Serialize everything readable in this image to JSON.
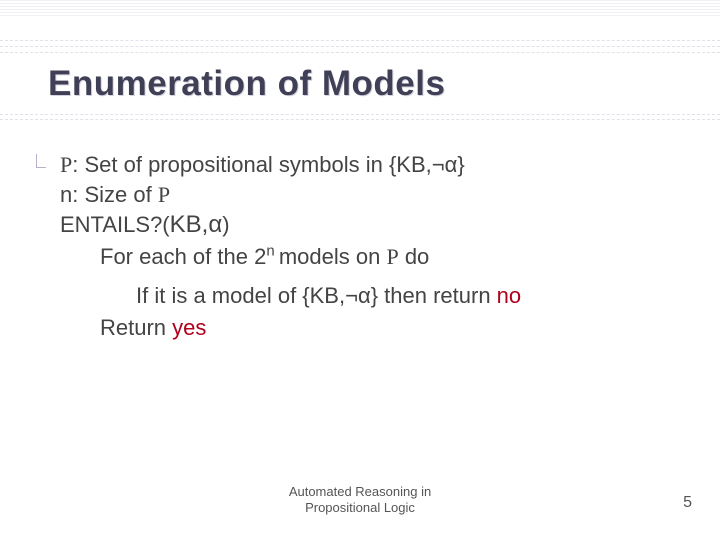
{
  "title": "Enumeration of Models",
  "def": {
    "p_label": "P",
    "p_text": ": Set of propositional symbols in {KB,",
    "p_tail": "}",
    "neg": "¬",
    "alpha": "α",
    "n_text": "n: Size of "
  },
  "entails": {
    "head_pre": "ENTAILS?(",
    "head_kb": "KB,",
    "head_post": ")",
    "foreach_a": "For each of the ",
    "two": "2",
    "exp": "n ",
    "foreach_b": "models on ",
    "foreach_c": " do",
    "if_a": "If it is a model of {KB,",
    "if_b": "} then return ",
    "no": "no",
    "return_a": "Return ",
    "yes": "yes"
  },
  "footer": {
    "line1": "Automated Reasoning in",
    "line2": "Propositional Logic"
  },
  "page": "5"
}
